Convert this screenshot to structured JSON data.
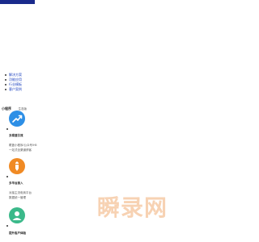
{
  "nav": {
    "items": [
      {
        "label": "解决方案"
      },
      {
        "label": "功能应用"
      },
      {
        "label": "行业模板"
      },
      {
        "label": "客户案例"
      }
    ]
  },
  "header": {
    "title": "小程序",
    "subtitle": "生态版"
  },
  "features": [
    {
      "icon": "arrow-chart-icon",
      "color": "#2d8fe6",
      "title": "多渠道引流",
      "lines": [
        "覆盖小程序/公众号/H5",
        "一站式全渠道获客"
      ]
    },
    {
      "icon": "pencil-icon",
      "color": "#f08a24",
      "title": "多平台接入",
      "lines": [
        "对接主流电商平台",
        "数据统一管理"
      ]
    },
    {
      "icon": "user-icon",
      "color": "#3bb98a",
      "title": "提升客户体验",
      "lines": []
    }
  ],
  "watermark": {
    "text": "瞬录网"
  },
  "colors": {
    "top_bar": "#1a2a8c",
    "link": "#1a3fbf",
    "watermark": "#f7d2b3"
  }
}
